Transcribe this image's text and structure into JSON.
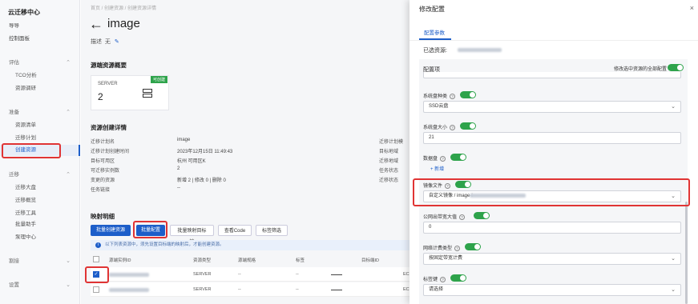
{
  "sidebar": {
    "title": "云迁移中心",
    "items": [
      {
        "label": "导导",
        "type": "top"
      },
      {
        "label": "控制面板",
        "type": "top"
      },
      {
        "label": "评估",
        "type": "group"
      },
      {
        "label": "TCO分析",
        "type": "sub"
      },
      {
        "label": "资源调研",
        "type": "sub"
      },
      {
        "label": "准备",
        "type": "group"
      },
      {
        "label": "资源清单",
        "type": "sub"
      },
      {
        "label": "迁移计划",
        "type": "sub"
      },
      {
        "label": "创建资源",
        "type": "sub",
        "active": true
      },
      {
        "label": "迁移",
        "type": "group"
      },
      {
        "label": "迁移大盘",
        "type": "sub"
      },
      {
        "label": "迁移概览",
        "type": "sub"
      },
      {
        "label": "迁移工具",
        "type": "sub"
      },
      {
        "label": "批量助手",
        "type": "sub"
      },
      {
        "label": "泵理中心",
        "type": "sub"
      },
      {
        "label": "割接",
        "type": "group"
      },
      {
        "label": "设置",
        "type": "group"
      }
    ]
  },
  "main": {
    "breadcrumb": "首页  /  创建资源  /  创建资源详情",
    "title": "image",
    "desc_label": "描述",
    "desc_value": "无",
    "source_section": "源端资源概要",
    "card": {
      "label": "SERVER",
      "count": "2",
      "badge": "可创建"
    },
    "detail_section": "资源创建详情",
    "details": [
      {
        "k": "迁移计划名",
        "v": "image"
      },
      {
        "k": "迁移计划创建时间",
        "v": "2023年12月15日 11:49:43"
      },
      {
        "k": "目标可用区",
        "v": "杭州 可用区K"
      },
      {
        "k": "可迁移实例数",
        "v": "2"
      },
      {
        "k": "变更的资源",
        "v": "新增 2  |  修改 0  |  删除 0"
      },
      {
        "k": "任务链接",
        "v": "--"
      }
    ],
    "right_labels": [
      "迁移计划模",
      "目标地域",
      "迁移地域",
      "任务状态",
      "迁移状态"
    ],
    "mapping_section": "映射明细",
    "buttons": [
      "批量创建资源",
      "批量配置",
      "批量映射目标端",
      "查看Code",
      "标签筛选"
    ],
    "notice": "以下列表资源中，须先设置目标端的映射后，才能创建资源。",
    "table_headers": [
      "源端实例ID",
      "资源类型",
      "源端规格",
      "标签",
      "目标端ID"
    ],
    "rows": [
      {
        "type": "SERVER",
        "spec": "--",
        "tags": "--",
        "target": "EC",
        "checked": true
      },
      {
        "type": "SERVER",
        "spec": "--",
        "tags": "--",
        "target": "EC",
        "checked": false
      }
    ]
  },
  "drawer": {
    "title": "修改配置",
    "close": "×",
    "tab": "配置参数",
    "selected_label": "已选资源:",
    "config_label": "配置项",
    "modify_all_label": "修改选中资源的全部配置",
    "fields": [
      {
        "label": "系统盘种类",
        "value": "SSD云盘",
        "dropdown": true
      },
      {
        "label": "系统盘大小",
        "value": "21",
        "dropdown": false
      },
      {
        "label": "数据盘",
        "value": "",
        "dropdown": false
      },
      {
        "label": "镜像文件",
        "value": "自定义镜像 / image-i",
        "dropdown": true
      },
      {
        "label": "公网出带宽大值",
        "value": "0",
        "dropdown": false
      },
      {
        "label": "网络计费类型",
        "value": "按固定带宽计费",
        "dropdown": true
      },
      {
        "label": "标签键",
        "value": "请选择",
        "dropdown": true
      }
    ],
    "add_link": "+ 新增"
  }
}
